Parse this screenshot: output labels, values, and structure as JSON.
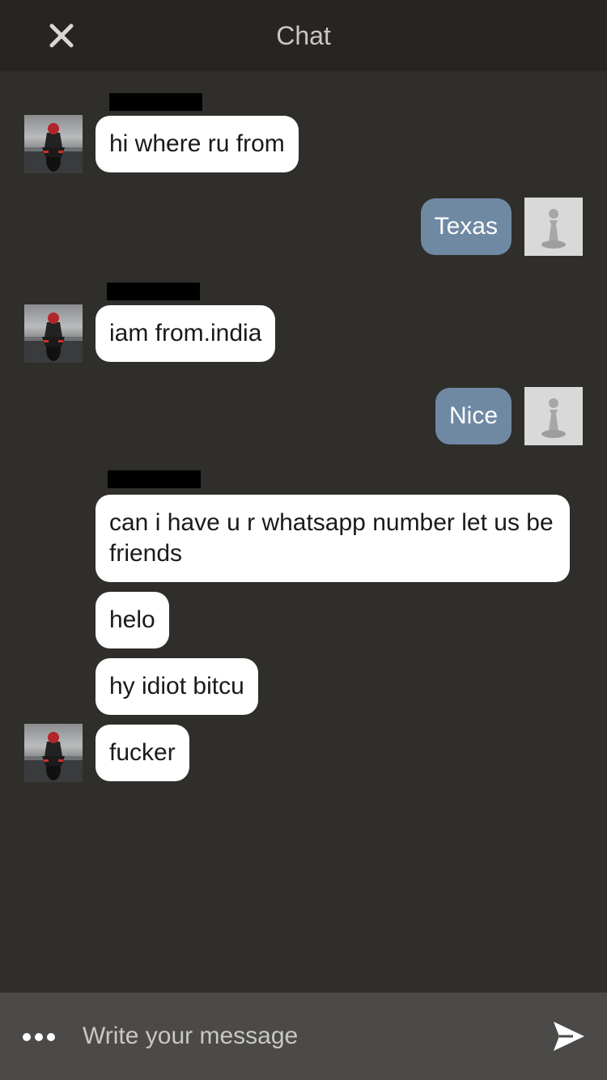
{
  "header": {
    "title": "Chat",
    "close_icon": "close-icon"
  },
  "messages": [
    {
      "direction": "incoming",
      "text": "hi where ru from"
    },
    {
      "direction": "outgoing",
      "text": "Texas"
    },
    {
      "direction": "incoming",
      "text": "iam from.india"
    },
    {
      "direction": "outgoing",
      "text": "Nice"
    },
    {
      "direction": "incoming",
      "text": "can i have u r whatsapp number let us be friends"
    },
    {
      "direction": "incoming",
      "text": "helo"
    },
    {
      "direction": "incoming",
      "text": "hy idiot bitcu"
    },
    {
      "direction": "incoming",
      "text": "fucker"
    }
  ],
  "composer": {
    "placeholder": "Write your message",
    "more_icon": "more-icon",
    "send_icon": "send-icon"
  },
  "colors": {
    "background": "#302e2b",
    "header": "#262523",
    "incoming_bubble": "#ffffff",
    "outgoing_bubble": "#6f89a3",
    "composer": "#4b4a48"
  }
}
